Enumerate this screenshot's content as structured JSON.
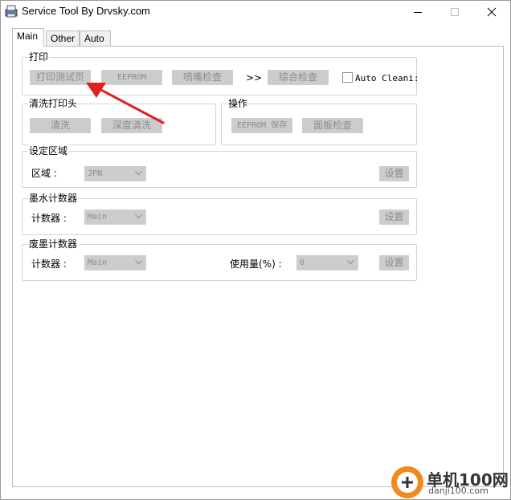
{
  "window": {
    "title": "Service Tool By Drvsky.com",
    "icons": {
      "app": "printer-app-icon",
      "minimize": "minimize-icon",
      "maximize": "maximize-icon",
      "close": "close-icon"
    }
  },
  "tabs": [
    {
      "label": "Main",
      "active": true
    },
    {
      "label": "Other",
      "active": false
    },
    {
      "label": "Auto",
      "active": false
    }
  ],
  "print_group": {
    "legend": "打印",
    "print_test_page": "打印测试页",
    "eeprom": "EEPROM",
    "nozzle_check": "喷嘴检查",
    "arrows": ">>",
    "combined_check": "综合检查",
    "auto_clean_label": "Auto Cleani:",
    "auto_clean_checked": false
  },
  "clean_group": {
    "legend": "清洗打印头",
    "clean": "清洗",
    "deep_clean": "深度清洗"
  },
  "operate_group": {
    "legend": "操作",
    "eeprom_save": "EEPROM 保存",
    "panel_check": "面板检查"
  },
  "region_group": {
    "legend": "设定区域",
    "region_label": "区域 :",
    "region_value": "JPN",
    "set_button": "设置"
  },
  "ink_counter_group": {
    "legend": "墨水计数器",
    "counter_label": "计数器 :",
    "counter_value": "Main",
    "set_button": "设置"
  },
  "waste_ink_group": {
    "legend": "废墨计数器",
    "counter_label": "计数器 :",
    "counter_value": "Main",
    "usage_label": "使用量(%) :",
    "usage_value": "0",
    "set_button": "设置"
  },
  "annotation": {
    "arrow_color": "#e02020"
  },
  "watermark": {
    "line1": "单机100网",
    "line2": "danji100.com",
    "color": "#f08a1a"
  }
}
